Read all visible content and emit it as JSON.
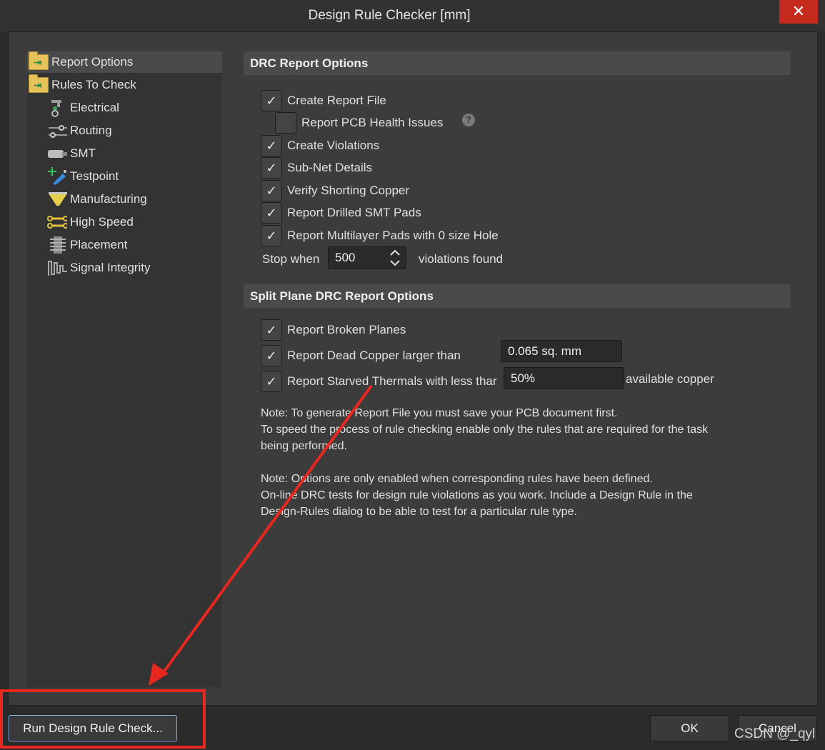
{
  "window": {
    "title": "Design Rule Checker [mm]",
    "close_glyph": "✕"
  },
  "tree": {
    "items": [
      {
        "label": "Report Options",
        "icon": "folder-icon"
      },
      {
        "label": "Rules To Check",
        "icon": "folder-icon"
      },
      {
        "label": "Electrical",
        "icon": "electrical-icon"
      },
      {
        "label": "Routing",
        "icon": "routing-icon"
      },
      {
        "label": "SMT",
        "icon": "smt-icon"
      },
      {
        "label": "Testpoint",
        "icon": "testpoint-icon"
      },
      {
        "label": "Manufacturing",
        "icon": "manufacturing-icon"
      },
      {
        "label": "High Speed",
        "icon": "high-speed-icon"
      },
      {
        "label": "Placement",
        "icon": "placement-icon"
      },
      {
        "label": "Signal Integrity",
        "icon": "signal-integrity-icon"
      }
    ],
    "selected": "Report Options"
  },
  "drc": {
    "header": "DRC Report Options",
    "options": [
      {
        "label": "Create Report File",
        "checked": true
      },
      {
        "label": "Report PCB Health Issues",
        "checked": false
      },
      {
        "label": "Create Violations",
        "checked": true
      },
      {
        "label": "Sub-Net Details",
        "checked": true
      },
      {
        "label": "Verify Shorting Copper",
        "checked": true
      },
      {
        "label": "Report Drilled SMT Pads",
        "checked": true
      },
      {
        "label": "Report Multilayer Pads with 0 size Hole",
        "checked": true
      }
    ],
    "help_glyph": "?",
    "stop_when_label": "Stop when",
    "stop_when_value": "500",
    "violations_found_label": "violations found"
  },
  "split": {
    "header": "Split Plane DRC Report Options",
    "broken_planes": {
      "label": "Report Broken Planes",
      "checked": true
    },
    "dead_copper": {
      "label": "Report Dead Copper larger than",
      "checked": true,
      "value": "0.065 sq. mm"
    },
    "starved": {
      "label": "Report Starved Thermals with less thar",
      "checked": true,
      "value": "50%",
      "suffix": "available copper"
    }
  },
  "notes": [
    "Note: To generate Report File you must save your PCB document first.",
    "To speed the process of rule checking enable only the rules that are required for the task",
    "being performed.",
    "",
    "Note: Options are only enabled when corresponding rules have been defined.",
    "On-line DRC tests for design rule violations as you work. Include a Design Rule in the",
    "Design-Rules dialog to be able to test for a particular rule  type."
  ],
  "footer": {
    "run_label": "Run Design Rule Check...",
    "ok_label": "OK",
    "cancel_label": "Cancel"
  },
  "watermark": "CSDN @_qyl",
  "colors": {
    "annotation": "#e8271f",
    "close": "#c42b1c",
    "focus": "#8fb8e8"
  }
}
